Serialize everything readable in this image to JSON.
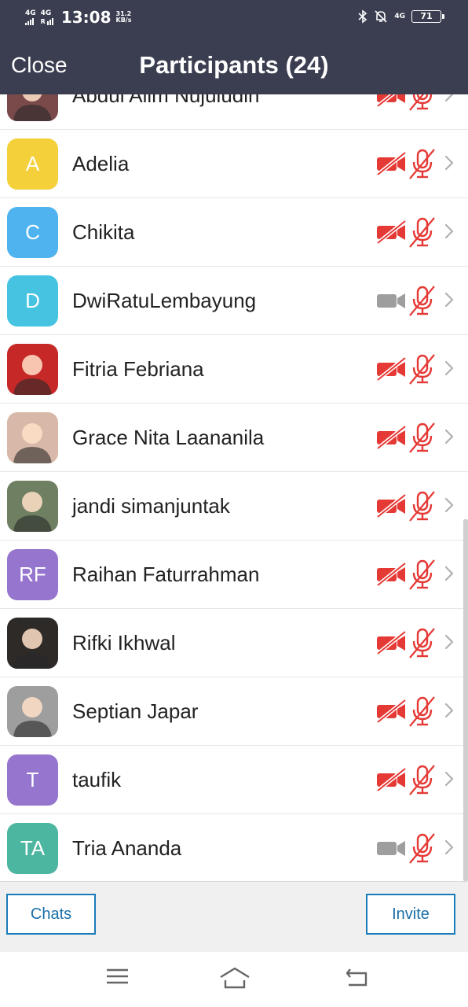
{
  "status_bar": {
    "net1_label": "4G",
    "net2_label": "4G",
    "net2_sub": "R",
    "time": "13:08",
    "speed_value": "31.2",
    "speed_unit": "KB/s",
    "net_right": "4G",
    "battery": "71"
  },
  "header": {
    "close_label": "Close",
    "title": "Participants (24)"
  },
  "participants": [
    {
      "name": "Abdul Alim Nujuludin",
      "initials": "",
      "avatar_color": "#7a4a4a",
      "video_muted": true,
      "audio_muted": true
    },
    {
      "name": "Adelia",
      "initials": "A",
      "avatar_color": "#f4d03a",
      "video_muted": true,
      "audio_muted": true
    },
    {
      "name": "Chikita",
      "initials": "C",
      "avatar_color": "#4fb3f0",
      "video_muted": true,
      "audio_muted": true
    },
    {
      "name": "DwiRatuLembayung",
      "initials": "D",
      "avatar_color": "#45c3e0",
      "video_muted": false,
      "audio_muted": true
    },
    {
      "name": "Fitria Febriana",
      "initials": "",
      "avatar_color": "#c62828",
      "video_muted": true,
      "audio_muted": true
    },
    {
      "name": "Grace Nita Laananila",
      "initials": "",
      "avatar_color": "#d8b8a8",
      "video_muted": true,
      "audio_muted": true
    },
    {
      "name": "jandi simanjuntak",
      "initials": "",
      "avatar_color": "#6f7f62",
      "video_muted": true,
      "audio_muted": true
    },
    {
      "name": "Raihan Faturrahman",
      "initials": "RF",
      "avatar_color": "#9575cd",
      "video_muted": true,
      "audio_muted": true
    },
    {
      "name": "Rifki Ikhwal",
      "initials": "",
      "avatar_color": "#2e2a28",
      "video_muted": true,
      "audio_muted": true
    },
    {
      "name": "Septian Japar",
      "initials": "",
      "avatar_color": "#9e9e9e",
      "video_muted": true,
      "audio_muted": true
    },
    {
      "name": "taufik",
      "initials": "T",
      "avatar_color": "#9575cd",
      "video_muted": true,
      "audio_muted": true
    },
    {
      "name": "Tria Ananda",
      "initials": "TA",
      "avatar_color": "#4db6a0",
      "video_muted": false,
      "audio_muted": true
    }
  ],
  "footer": {
    "chats_label": "Chats",
    "invite_label": "Invite"
  },
  "colors": {
    "header_bg": "#3b3e50",
    "muted_red": "#e53935",
    "video_on_gray": "#9e9e9e",
    "button_blue": "#1a7bb8"
  },
  "icons": {
    "video": "video-camera-icon",
    "mic": "microphone-icon",
    "chevron": "chevron-right-icon",
    "nav_menu": "menu-icon",
    "nav_home": "home-icon",
    "nav_back": "back-icon"
  }
}
